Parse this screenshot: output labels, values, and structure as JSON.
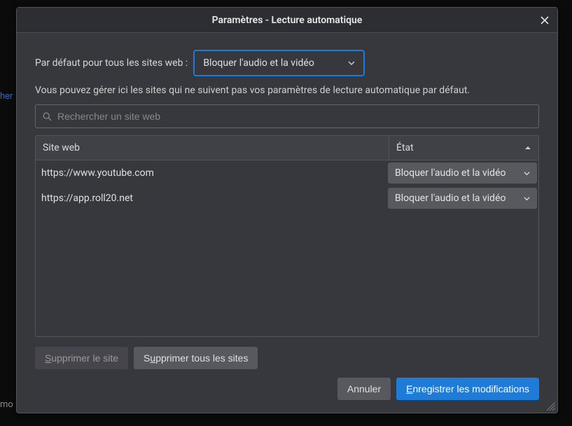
{
  "bg": {
    "hint1": "her",
    "hint2": "mo"
  },
  "dialog": {
    "title": "Paramètres - Lecture automatique",
    "default_label": "Par défaut pour tous les sites web :",
    "default_value": "Bloquer l'audio et la vidéo",
    "help_text": "Vous pouvez gérer ici les sites qui ne suivent pas vos paramètres de lecture automatique par défaut.",
    "search_placeholder": "Rechercher un site web",
    "columns": {
      "site": "Site web",
      "state": "État"
    },
    "rows": [
      {
        "site": "https://www.youtube.com",
        "state": "Bloquer l'audio et la vidéo"
      },
      {
        "site": "https://app.roll20.net",
        "state": "Bloquer l'audio et la vidéo"
      }
    ],
    "buttons": {
      "remove_site_pre": "S",
      "remove_site_post": "upprimer le site",
      "remove_all_pre": "S",
      "remove_all_mid": "u",
      "remove_all_post": "pprimer tous les sites",
      "cancel": "Annuler",
      "save_pre": "E",
      "save_post": "nregistrer les modifications"
    }
  }
}
